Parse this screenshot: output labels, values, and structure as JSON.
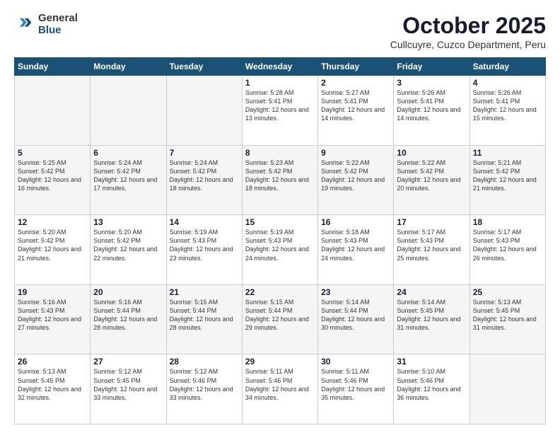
{
  "logo": {
    "general": "General",
    "blue": "Blue"
  },
  "header": {
    "month": "October 2025",
    "location": "Cullcuyre, Cuzco Department, Peru"
  },
  "weekdays": [
    "Sunday",
    "Monday",
    "Tuesday",
    "Wednesday",
    "Thursday",
    "Friday",
    "Saturday"
  ],
  "weeks": [
    [
      {
        "day": "",
        "empty": true
      },
      {
        "day": "",
        "empty": true
      },
      {
        "day": "",
        "empty": true
      },
      {
        "day": "1",
        "sunrise": "5:28 AM",
        "sunset": "5:41 PM",
        "daylight": "12 hours and 13 minutes."
      },
      {
        "day": "2",
        "sunrise": "5:27 AM",
        "sunset": "5:41 PM",
        "daylight": "12 hours and 14 minutes."
      },
      {
        "day": "3",
        "sunrise": "5:26 AM",
        "sunset": "5:41 PM",
        "daylight": "12 hours and 14 minutes."
      },
      {
        "day": "4",
        "sunrise": "5:26 AM",
        "sunset": "5:41 PM",
        "daylight": "12 hours and 15 minutes."
      }
    ],
    [
      {
        "day": "5",
        "sunrise": "5:25 AM",
        "sunset": "5:42 PM",
        "daylight": "12 hours and 16 minutes."
      },
      {
        "day": "6",
        "sunrise": "5:24 AM",
        "sunset": "5:42 PM",
        "daylight": "12 hours and 17 minutes."
      },
      {
        "day": "7",
        "sunrise": "5:24 AM",
        "sunset": "5:42 PM",
        "daylight": "12 hours and 18 minutes."
      },
      {
        "day": "8",
        "sunrise": "5:23 AM",
        "sunset": "5:42 PM",
        "daylight": "12 hours and 18 minutes."
      },
      {
        "day": "9",
        "sunrise": "5:22 AM",
        "sunset": "5:42 PM",
        "daylight": "12 hours and 19 minutes."
      },
      {
        "day": "10",
        "sunrise": "5:22 AM",
        "sunset": "5:42 PM",
        "daylight": "12 hours and 20 minutes."
      },
      {
        "day": "11",
        "sunrise": "5:21 AM",
        "sunset": "5:42 PM",
        "daylight": "12 hours and 21 minutes."
      }
    ],
    [
      {
        "day": "12",
        "sunrise": "5:20 AM",
        "sunset": "5:42 PM",
        "daylight": "12 hours and 21 minutes."
      },
      {
        "day": "13",
        "sunrise": "5:20 AM",
        "sunset": "5:42 PM",
        "daylight": "12 hours and 22 minutes."
      },
      {
        "day": "14",
        "sunrise": "5:19 AM",
        "sunset": "5:43 PM",
        "daylight": "12 hours and 23 minutes."
      },
      {
        "day": "15",
        "sunrise": "5:19 AM",
        "sunset": "5:43 PM",
        "daylight": "12 hours and 24 minutes."
      },
      {
        "day": "16",
        "sunrise": "5:18 AM",
        "sunset": "5:43 PM",
        "daylight": "12 hours and 24 minutes."
      },
      {
        "day": "17",
        "sunrise": "5:17 AM",
        "sunset": "5:43 PM",
        "daylight": "12 hours and 25 minutes."
      },
      {
        "day": "18",
        "sunrise": "5:17 AM",
        "sunset": "5:43 PM",
        "daylight": "12 hours and 26 minutes."
      }
    ],
    [
      {
        "day": "19",
        "sunrise": "5:16 AM",
        "sunset": "5:43 PM",
        "daylight": "12 hours and 27 minutes."
      },
      {
        "day": "20",
        "sunrise": "5:16 AM",
        "sunset": "5:44 PM",
        "daylight": "12 hours and 28 minutes."
      },
      {
        "day": "21",
        "sunrise": "5:15 AM",
        "sunset": "5:44 PM",
        "daylight": "12 hours and 28 minutes."
      },
      {
        "day": "22",
        "sunrise": "5:15 AM",
        "sunset": "5:44 PM",
        "daylight": "12 hours and 29 minutes."
      },
      {
        "day": "23",
        "sunrise": "5:14 AM",
        "sunset": "5:44 PM",
        "daylight": "12 hours and 30 minutes."
      },
      {
        "day": "24",
        "sunrise": "5:14 AM",
        "sunset": "5:45 PM",
        "daylight": "12 hours and 31 minutes."
      },
      {
        "day": "25",
        "sunrise": "5:13 AM",
        "sunset": "5:45 PM",
        "daylight": "12 hours and 31 minutes."
      }
    ],
    [
      {
        "day": "26",
        "sunrise": "5:13 AM",
        "sunset": "5:45 PM",
        "daylight": "12 hours and 32 minutes."
      },
      {
        "day": "27",
        "sunrise": "5:12 AM",
        "sunset": "5:45 PM",
        "daylight": "12 hours and 33 minutes."
      },
      {
        "day": "28",
        "sunrise": "5:12 AM",
        "sunset": "5:46 PM",
        "daylight": "12 hours and 33 minutes."
      },
      {
        "day": "29",
        "sunrise": "5:11 AM",
        "sunset": "5:46 PM",
        "daylight": "12 hours and 34 minutes."
      },
      {
        "day": "30",
        "sunrise": "5:11 AM",
        "sunset": "5:46 PM",
        "daylight": "12 hours and 35 minutes."
      },
      {
        "day": "31",
        "sunrise": "5:10 AM",
        "sunset": "5:46 PM",
        "daylight": "12 hours and 36 minutes."
      },
      {
        "day": "",
        "empty": true
      }
    ]
  ]
}
